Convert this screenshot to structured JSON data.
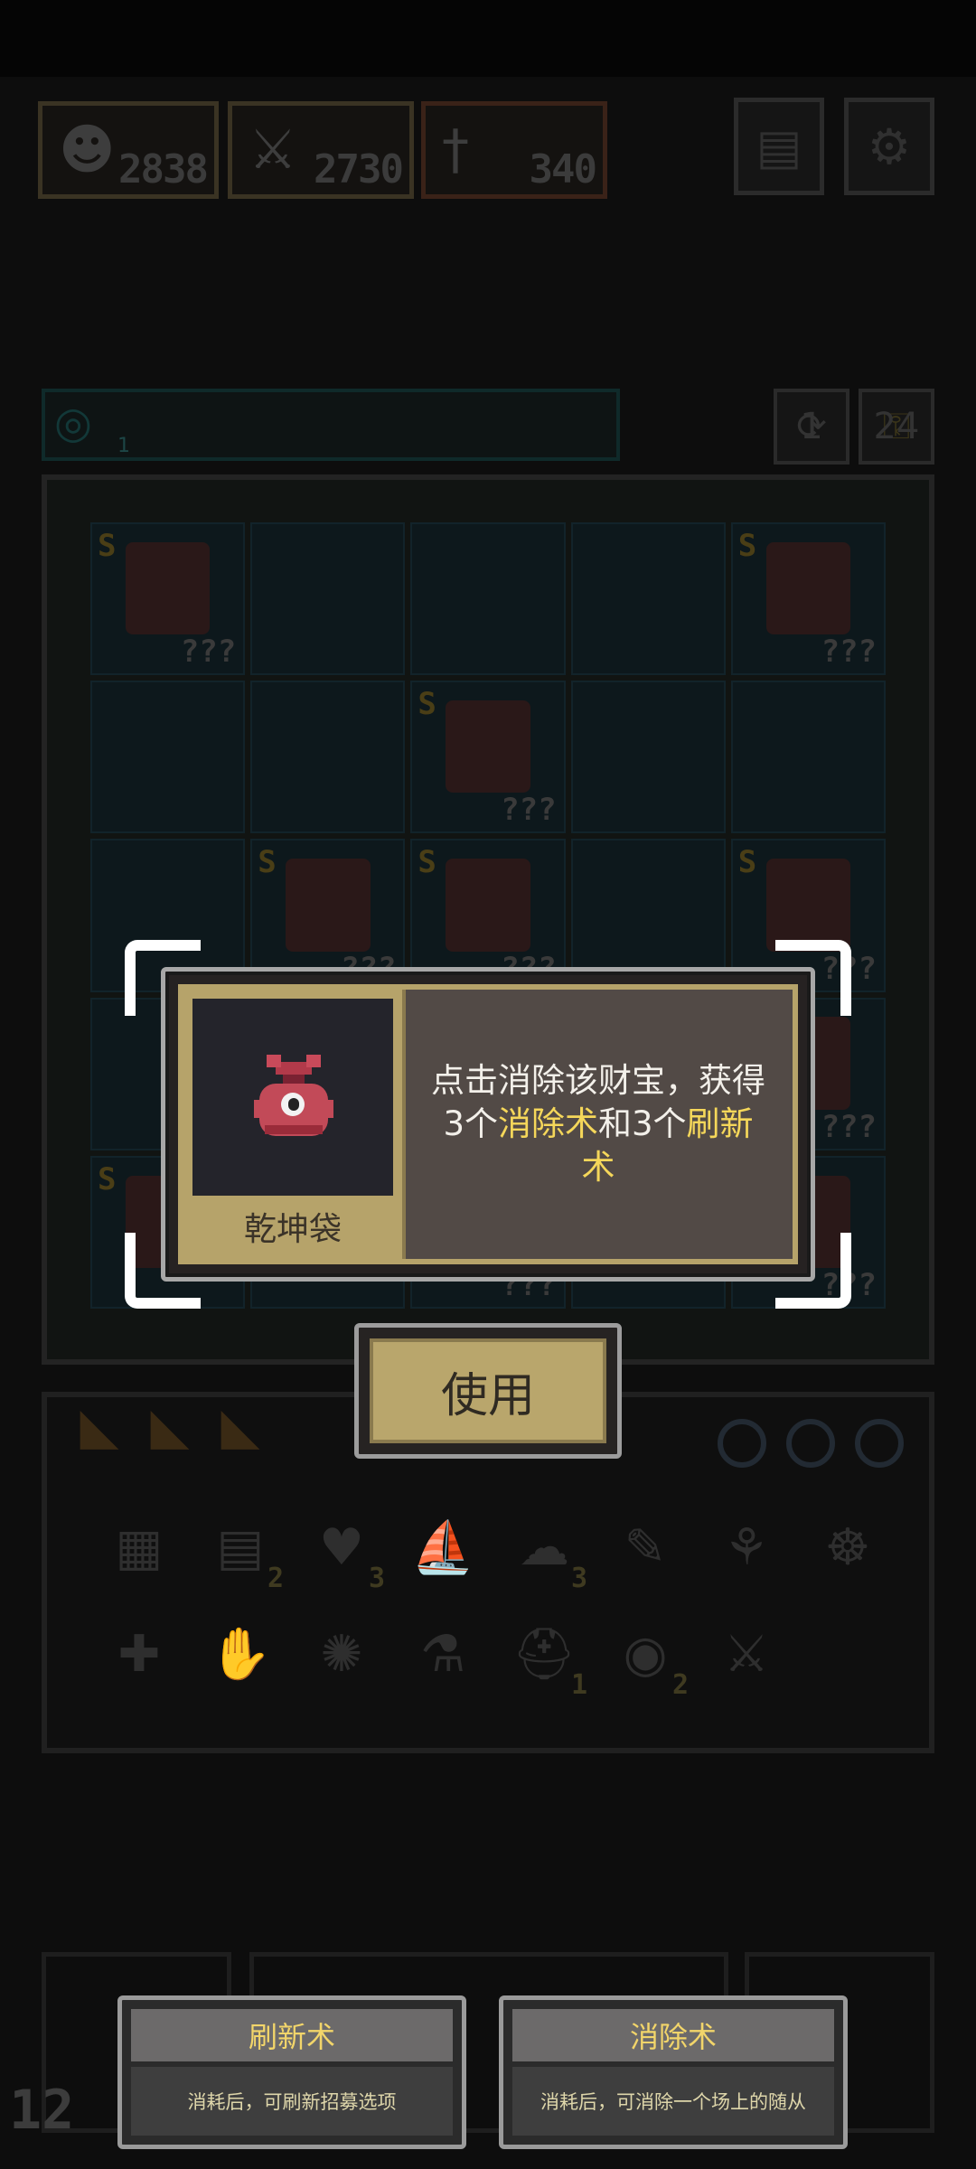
{
  "stats": {
    "hp": "2838",
    "attack": "2730",
    "weapon": "340"
  },
  "board": {
    "timer_count": "1",
    "refresh_count": "1",
    "remove_count": "24",
    "cells": [
      {
        "tier": "S",
        "qm": "???",
        "hero": true
      },
      {
        "tier": "",
        "qm": "",
        "hero": false
      },
      {
        "tier": "",
        "qm": "",
        "hero": false
      },
      {
        "tier": "",
        "qm": "",
        "hero": false
      },
      {
        "tier": "S",
        "qm": "???",
        "hero": true
      },
      {
        "tier": "",
        "qm": "",
        "hero": false
      },
      {
        "tier": "",
        "qm": "",
        "hero": false
      },
      {
        "tier": "S",
        "qm": "???",
        "hero": true
      },
      {
        "tier": "",
        "qm": "",
        "hero": false
      },
      {
        "tier": "",
        "qm": "",
        "hero": false
      },
      {
        "tier": "",
        "qm": "",
        "hero": false
      },
      {
        "tier": "S",
        "qm": "???",
        "hero": true
      },
      {
        "tier": "S",
        "qm": "???",
        "hero": true
      },
      {
        "tier": "",
        "qm": "",
        "hero": false
      },
      {
        "tier": "S",
        "qm": "???",
        "hero": true
      },
      {
        "tier": "",
        "qm": "",
        "hero": false
      },
      {
        "tier": "",
        "qm": "",
        "hero": false
      },
      {
        "tier": "",
        "qm": "",
        "hero": false
      },
      {
        "tier": "",
        "qm": "",
        "hero": false
      },
      {
        "tier": "",
        "qm": "???",
        "hero": true
      },
      {
        "tier": "S",
        "qm": "",
        "hero": true
      },
      {
        "tier": "",
        "qm": "",
        "hero": false
      },
      {
        "tier": "",
        "qm": "???",
        "hero": true
      },
      {
        "tier": "",
        "qm": "",
        "hero": false
      },
      {
        "tier": "",
        "qm": "???",
        "hero": true
      }
    ]
  },
  "inventory": {
    "row1_counts": [
      "",
      "2",
      "3",
      "",
      "3",
      "",
      "",
      ""
    ],
    "row2_counts": [
      "",
      "",
      "",
      "",
      "1",
      "2",
      ""
    ]
  },
  "wave": "12",
  "popup": {
    "item_name": "乾坤袋",
    "desc_part1": "点击消除该财宝，获得3个",
    "desc_hl1": "消除术",
    "desc_part2": "和3个",
    "desc_hl2": "刷新术",
    "use_label": "使用"
  },
  "cards": [
    {
      "title": "刷新术",
      "body": "消耗后，可刷新招募选项"
    },
    {
      "title": "消除术",
      "body": "消耗后，可消除一个场上的随从"
    }
  ],
  "colors": {
    "accent_gold": "#b6a36a",
    "highlight_yellow": "#f5d75a",
    "popup_bg": "#524a46"
  },
  "icons": [
    "hero-icon",
    "sword-icon",
    "dagger-icon",
    "book-icon",
    "gear-icon",
    "timer-icon",
    "refresh-icon",
    "remove-icon",
    "bag-icon"
  ]
}
